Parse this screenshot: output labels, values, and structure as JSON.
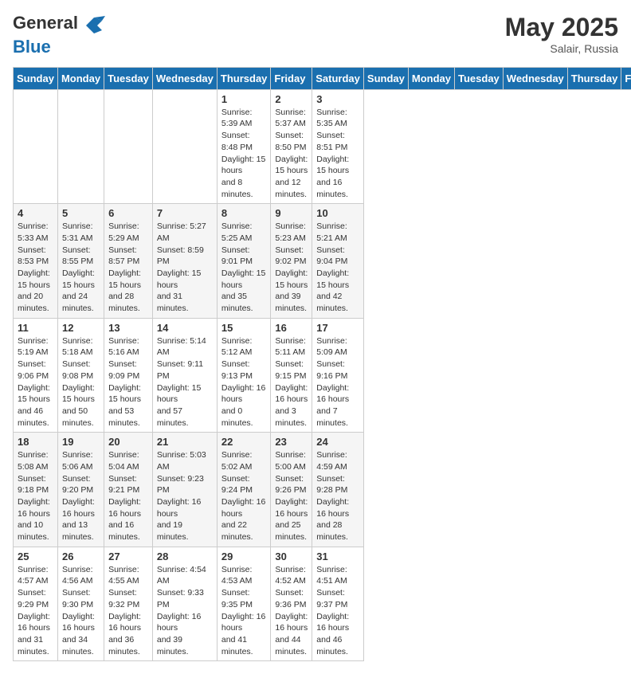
{
  "header": {
    "logo_general": "General",
    "logo_blue": "Blue",
    "month_year": "May 2025",
    "location": "Salair, Russia"
  },
  "days_of_week": [
    "Sunday",
    "Monday",
    "Tuesday",
    "Wednesday",
    "Thursday",
    "Friday",
    "Saturday"
  ],
  "weeks": [
    [
      {
        "day": "",
        "info": ""
      },
      {
        "day": "",
        "info": ""
      },
      {
        "day": "",
        "info": ""
      },
      {
        "day": "",
        "info": ""
      },
      {
        "day": "1",
        "info": "Sunrise: 5:39 AM\nSunset: 8:48 PM\nDaylight: 15 hours\nand 8 minutes."
      },
      {
        "day": "2",
        "info": "Sunrise: 5:37 AM\nSunset: 8:50 PM\nDaylight: 15 hours\nand 12 minutes."
      },
      {
        "day": "3",
        "info": "Sunrise: 5:35 AM\nSunset: 8:51 PM\nDaylight: 15 hours\nand 16 minutes."
      }
    ],
    [
      {
        "day": "4",
        "info": "Sunrise: 5:33 AM\nSunset: 8:53 PM\nDaylight: 15 hours\nand 20 minutes."
      },
      {
        "day": "5",
        "info": "Sunrise: 5:31 AM\nSunset: 8:55 PM\nDaylight: 15 hours\nand 24 minutes."
      },
      {
        "day": "6",
        "info": "Sunrise: 5:29 AM\nSunset: 8:57 PM\nDaylight: 15 hours\nand 28 minutes."
      },
      {
        "day": "7",
        "info": "Sunrise: 5:27 AM\nSunset: 8:59 PM\nDaylight: 15 hours\nand 31 minutes."
      },
      {
        "day": "8",
        "info": "Sunrise: 5:25 AM\nSunset: 9:01 PM\nDaylight: 15 hours\nand 35 minutes."
      },
      {
        "day": "9",
        "info": "Sunrise: 5:23 AM\nSunset: 9:02 PM\nDaylight: 15 hours\nand 39 minutes."
      },
      {
        "day": "10",
        "info": "Sunrise: 5:21 AM\nSunset: 9:04 PM\nDaylight: 15 hours\nand 42 minutes."
      }
    ],
    [
      {
        "day": "11",
        "info": "Sunrise: 5:19 AM\nSunset: 9:06 PM\nDaylight: 15 hours\nand 46 minutes."
      },
      {
        "day": "12",
        "info": "Sunrise: 5:18 AM\nSunset: 9:08 PM\nDaylight: 15 hours\nand 50 minutes."
      },
      {
        "day": "13",
        "info": "Sunrise: 5:16 AM\nSunset: 9:09 PM\nDaylight: 15 hours\nand 53 minutes."
      },
      {
        "day": "14",
        "info": "Sunrise: 5:14 AM\nSunset: 9:11 PM\nDaylight: 15 hours\nand 57 minutes."
      },
      {
        "day": "15",
        "info": "Sunrise: 5:12 AM\nSunset: 9:13 PM\nDaylight: 16 hours\nand 0 minutes."
      },
      {
        "day": "16",
        "info": "Sunrise: 5:11 AM\nSunset: 9:15 PM\nDaylight: 16 hours\nand 3 minutes."
      },
      {
        "day": "17",
        "info": "Sunrise: 5:09 AM\nSunset: 9:16 PM\nDaylight: 16 hours\nand 7 minutes."
      }
    ],
    [
      {
        "day": "18",
        "info": "Sunrise: 5:08 AM\nSunset: 9:18 PM\nDaylight: 16 hours\nand 10 minutes."
      },
      {
        "day": "19",
        "info": "Sunrise: 5:06 AM\nSunset: 9:20 PM\nDaylight: 16 hours\nand 13 minutes."
      },
      {
        "day": "20",
        "info": "Sunrise: 5:04 AM\nSunset: 9:21 PM\nDaylight: 16 hours\nand 16 minutes."
      },
      {
        "day": "21",
        "info": "Sunrise: 5:03 AM\nSunset: 9:23 PM\nDaylight: 16 hours\nand 19 minutes."
      },
      {
        "day": "22",
        "info": "Sunrise: 5:02 AM\nSunset: 9:24 PM\nDaylight: 16 hours\nand 22 minutes."
      },
      {
        "day": "23",
        "info": "Sunrise: 5:00 AM\nSunset: 9:26 PM\nDaylight: 16 hours\nand 25 minutes."
      },
      {
        "day": "24",
        "info": "Sunrise: 4:59 AM\nSunset: 9:28 PM\nDaylight: 16 hours\nand 28 minutes."
      }
    ],
    [
      {
        "day": "25",
        "info": "Sunrise: 4:57 AM\nSunset: 9:29 PM\nDaylight: 16 hours\nand 31 minutes."
      },
      {
        "day": "26",
        "info": "Sunrise: 4:56 AM\nSunset: 9:30 PM\nDaylight: 16 hours\nand 34 minutes."
      },
      {
        "day": "27",
        "info": "Sunrise: 4:55 AM\nSunset: 9:32 PM\nDaylight: 16 hours\nand 36 minutes."
      },
      {
        "day": "28",
        "info": "Sunrise: 4:54 AM\nSunset: 9:33 PM\nDaylight: 16 hours\nand 39 minutes."
      },
      {
        "day": "29",
        "info": "Sunrise: 4:53 AM\nSunset: 9:35 PM\nDaylight: 16 hours\nand 41 minutes."
      },
      {
        "day": "30",
        "info": "Sunrise: 4:52 AM\nSunset: 9:36 PM\nDaylight: 16 hours\nand 44 minutes."
      },
      {
        "day": "31",
        "info": "Sunrise: 4:51 AM\nSunset: 9:37 PM\nDaylight: 16 hours\nand 46 minutes."
      }
    ]
  ]
}
